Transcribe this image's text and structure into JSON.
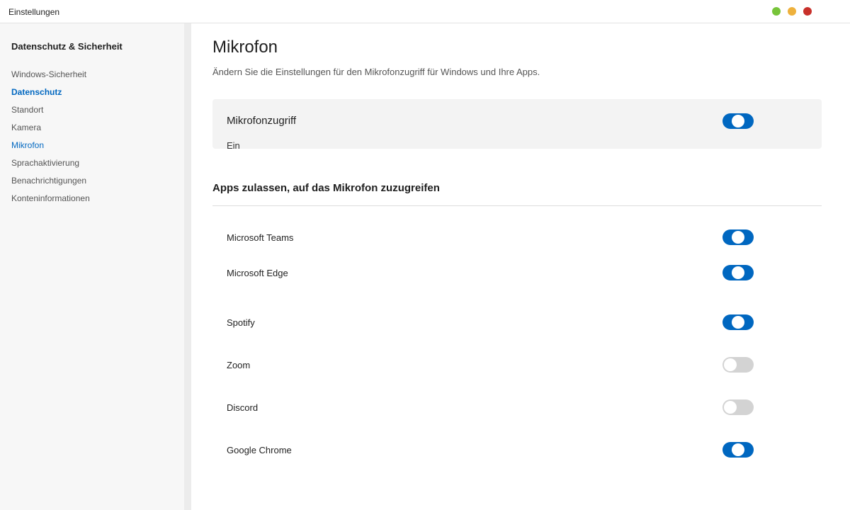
{
  "window": {
    "title": "Einstellungen",
    "controls": [
      {
        "name": "maximize-button",
        "color": "#77c43a"
      },
      {
        "name": "minimize-button",
        "color": "#eeb13d"
      },
      {
        "name": "close-button",
        "color": "#c8302a"
      }
    ]
  },
  "sidebar": {
    "section_title": "Datenschutz & Sicherheit",
    "items": [
      {
        "label": "Windows-Sicherheit",
        "state": "normal"
      },
      {
        "label": "Datenschutz",
        "state": "active"
      },
      {
        "label": "Standort",
        "state": "normal"
      },
      {
        "label": "Kamera",
        "state": "normal"
      },
      {
        "label": "Mikrofon",
        "state": "current"
      },
      {
        "label": "Sprachaktivierung",
        "state": "normal"
      },
      {
        "label": "Benachrichtigungen",
        "state": "normal"
      },
      {
        "label": "Konteninformationen",
        "state": "normal"
      }
    ]
  },
  "main": {
    "title": "Mikrofon",
    "description": "Ändern Sie die Einstellungen für den Mikrofonzugriff für Windows und Ihre Apps.",
    "access": {
      "title": "Mikrofonzugriff",
      "status": "Ein",
      "enabled": true
    },
    "apps_heading": "Apps zulassen, auf das Mikrofon zuzugreifen",
    "apps": [
      {
        "name": "Microsoft Teams",
        "enabled": true
      },
      {
        "name": "Microsoft Edge",
        "enabled": true
      },
      {
        "name": "Spotify",
        "enabled": true
      },
      {
        "name": "Zoom",
        "enabled": false
      },
      {
        "name": "Discord",
        "enabled": false
      },
      {
        "name": "Google Chrome",
        "enabled": true
      }
    ]
  },
  "colors": {
    "accent": "#0067c0",
    "toggle_off": "#d3d3d3"
  }
}
